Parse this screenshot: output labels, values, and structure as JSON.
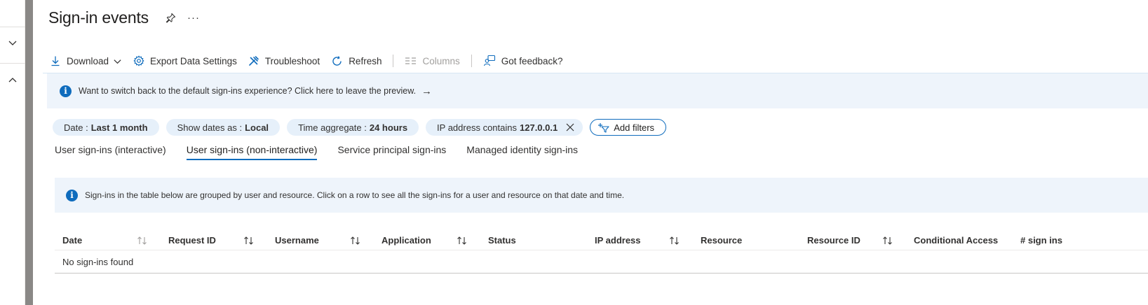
{
  "page": {
    "title": "Sign-in events",
    "more_label": "···"
  },
  "toolbar": {
    "download": "Download",
    "export": "Export Data Settings",
    "troubleshoot": "Troubleshoot",
    "refresh": "Refresh",
    "columns": "Columns",
    "feedback": "Got feedback?"
  },
  "preview_banner": {
    "text": "Want to switch back to the default sign-ins experience? Click here to leave the preview.",
    "arrow": "→"
  },
  "filters": [
    {
      "label": "Date :",
      "value": "Last 1 month"
    },
    {
      "label": "Show dates as :",
      "value": "Local"
    },
    {
      "label": "Time aggregate :",
      "value": "24 hours"
    },
    {
      "label": "IP address contains",
      "value": "127.0.0.1"
    }
  ],
  "add_filters": "Add filters",
  "tabs": [
    {
      "label": "User sign-ins (interactive)",
      "active": false
    },
    {
      "label": "User sign-ins (non-interactive)",
      "active": true
    },
    {
      "label": "Service principal sign-ins",
      "active": false
    },
    {
      "label": "Managed identity sign-ins",
      "active": false
    }
  ],
  "group_banner": {
    "text": "Sign-ins in the table below are grouped by user and resource. Click on a row to see all the sign-ins for a user and resource on that date and time."
  },
  "table": {
    "columns": [
      {
        "label": "Date",
        "sortable": true,
        "muted": true
      },
      {
        "label": "Request ID",
        "sortable": true
      },
      {
        "label": "Username",
        "sortable": true
      },
      {
        "label": "Application",
        "sortable": true
      },
      {
        "label": "Status",
        "sortable": false
      },
      {
        "label": "IP address",
        "sortable": true
      },
      {
        "label": "Resource",
        "sortable": false
      },
      {
        "label": "Resource ID",
        "sortable": true
      },
      {
        "label": "Conditional Access",
        "sortable": false
      },
      {
        "label": "# sign ins",
        "sortable": false
      }
    ],
    "empty_message": "No sign-ins found"
  },
  "colors": {
    "accent": "#0f6cbd",
    "banner_bg": "#eef4fb",
    "pill_bg": "#e6f0fa"
  }
}
